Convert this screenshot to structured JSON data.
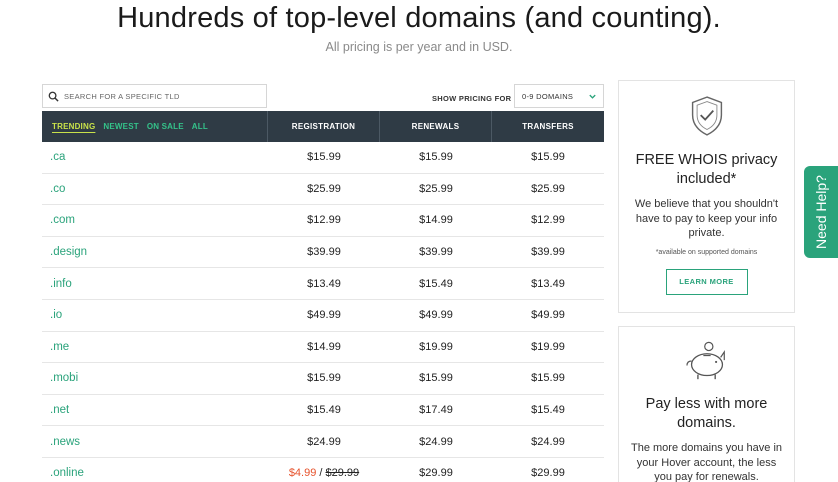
{
  "header": {
    "title": "Hundreds of top-level domains (and counting).",
    "subtitle": "All pricing is per year and in USD."
  },
  "search": {
    "placeholder": "SEARCH FOR A SPECIFIC TLD"
  },
  "show_pricing": {
    "label": "SHOW PRICING FOR",
    "selected": "0-9 DOMAINS"
  },
  "filters": [
    {
      "label": "TRENDING",
      "active": true
    },
    {
      "label": "NEWEST",
      "active": false
    },
    {
      "label": "ON SALE",
      "active": false
    },
    {
      "label": "ALL",
      "active": false
    }
  ],
  "columns": [
    "REGISTRATION",
    "RENEWALS",
    "TRANSFERS"
  ],
  "rows": [
    {
      "tld": ".ca",
      "registration": "$15.99",
      "renewal": "$15.99",
      "transfer": "$15.99"
    },
    {
      "tld": ".co",
      "registration": "$25.99",
      "renewal": "$25.99",
      "transfer": "$25.99"
    },
    {
      "tld": ".com",
      "registration": "$12.99",
      "renewal": "$14.99",
      "transfer": "$12.99"
    },
    {
      "tld": ".design",
      "registration": "$39.99",
      "renewal": "$39.99",
      "transfer": "$39.99"
    },
    {
      "tld": ".info",
      "registration": "$13.49",
      "renewal": "$15.49",
      "transfer": "$13.49"
    },
    {
      "tld": ".io",
      "registration": "$49.99",
      "renewal": "$49.99",
      "transfer": "$49.99"
    },
    {
      "tld": ".me",
      "registration": "$14.99",
      "renewal": "$19.99",
      "transfer": "$19.99"
    },
    {
      "tld": ".mobi",
      "registration": "$15.99",
      "renewal": "$15.99",
      "transfer": "$15.99"
    },
    {
      "tld": ".net",
      "registration": "$15.49",
      "renewal": "$17.49",
      "transfer": "$15.49"
    },
    {
      "tld": ".news",
      "registration": "$24.99",
      "renewal": "$24.99",
      "transfer": "$24.99"
    },
    {
      "tld": ".online",
      "registration": "$29.99",
      "sale_price": "$4.99",
      "renewal": "$29.99",
      "transfer": "$29.99"
    }
  ],
  "whois_card": {
    "title": "FREE WHOIS privacy included*",
    "description": "We believe that you shouldn't have to pay to keep your info private.",
    "note": "*available on supported domains",
    "button": "LEARN MORE",
    "icon": "shield-check-icon"
  },
  "bulk_card": {
    "title": "Pay less with more domains.",
    "description": "The more domains you have in your Hover account, the less you pay for renewals.",
    "icon": "piggy-bank-icon"
  },
  "help_tab": {
    "label": "Need Help?"
  },
  "colors": {
    "accent": "#2aa37b",
    "header_bg": "#2f3b45",
    "active_filter": "#c9e24a",
    "sale": "#e6522c"
  }
}
